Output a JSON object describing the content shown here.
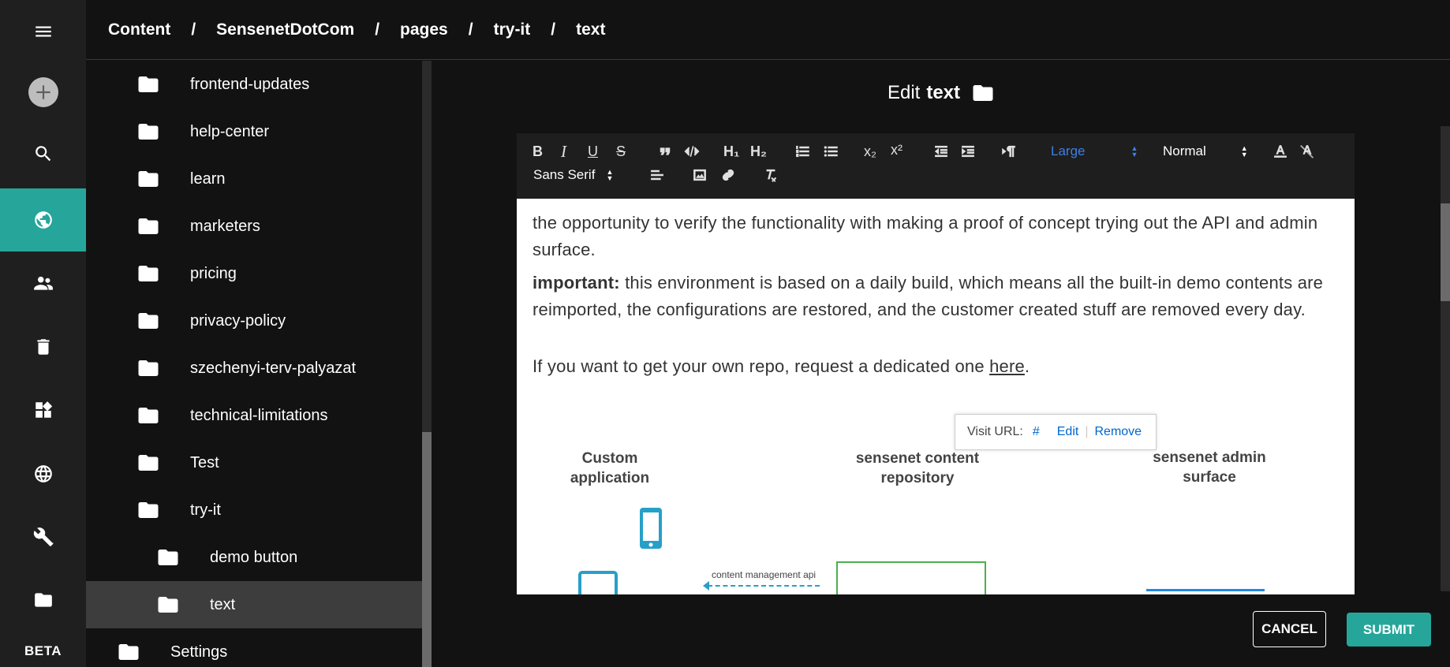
{
  "breadcrumb": [
    "Content",
    "SensenetDotCom",
    "pages",
    "try-it",
    "text"
  ],
  "breadcrumb_separator": "/",
  "rail": {
    "items": [
      "menu-icon",
      "add-icon",
      "search-icon",
      "globe-filled-icon",
      "users-icon",
      "trash-icon",
      "dashboard-icon",
      "globe-outline-icon",
      "wrench-icon",
      "folder-icon"
    ],
    "active": "globe-filled-icon",
    "beta_label": "BETA"
  },
  "tree": {
    "items": [
      {
        "label": "frontend-updates"
      },
      {
        "label": "help-center"
      },
      {
        "label": "learn"
      },
      {
        "label": "marketers"
      },
      {
        "label": "pricing"
      },
      {
        "label": "privacy-policy"
      },
      {
        "label": "szechenyi-terv-palyazat"
      },
      {
        "label": "technical-limitations"
      },
      {
        "label": "Test"
      },
      {
        "label": "try-it"
      },
      {
        "label": "demo button"
      },
      {
        "label": "text",
        "selected": true
      },
      {
        "label": "Settings"
      }
    ]
  },
  "editor": {
    "title_prefix": "Edit",
    "title_name": "text",
    "toolbar": {
      "bold": "B",
      "italic": "I",
      "underline": "U",
      "strike": "S",
      "h1": "H₁",
      "h2": "H₂",
      "subscript": "x₂",
      "superscript": "x²",
      "size_value": "Large",
      "header_value": "Normal",
      "font_value": "Sans Serif"
    },
    "paragraphs": {
      "p1": "the opportunity to verify the functionality with making a proof of concept trying out the API and admin surface.",
      "p2_strong": "important:",
      "p2_rest": " this environment is based on a daily build, which means all the built-in demo contents are reimported, the configurations are restored, and the customer created stuff are removed every day.",
      "p3_pre": "If you want to get your own repo, request a dedicated one ",
      "p3_link": "here",
      "p3_post": "."
    },
    "link_tooltip": {
      "label": "Visit URL:",
      "url": "#",
      "edit": "Edit",
      "remove": "Remove"
    },
    "diagram": {
      "col1": "Custom application",
      "col2_line1": "sensenet content",
      "col2_line2": "repository",
      "col3_line1": "sensenet admin",
      "col3_line2": "surface",
      "api_label": "content management api"
    }
  },
  "actions": {
    "cancel": "CANCEL",
    "submit": "SUBMIT"
  },
  "colors": {
    "accent": "#26a69a",
    "link": "#0066cc"
  }
}
